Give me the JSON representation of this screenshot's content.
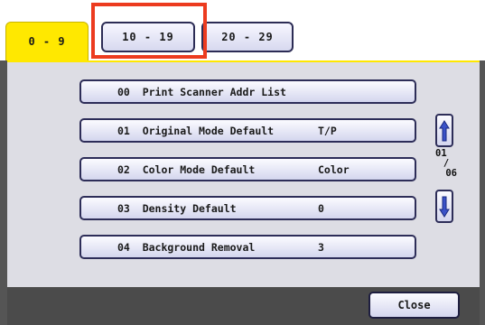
{
  "tabs": [
    {
      "label": "0 - 9",
      "active": true
    },
    {
      "label": "10 - 19",
      "active": false
    },
    {
      "label": "20 - 29",
      "active": false
    }
  ],
  "rows": [
    {
      "label": "00  Print Scanner Addr List",
      "value": ""
    },
    {
      "label": "01  Original Mode Default",
      "value": "T/P"
    },
    {
      "label": "02  Color Mode Default",
      "value": "Color"
    },
    {
      "label": "03  Density Default",
      "value": "0"
    },
    {
      "label": "04  Background Removal",
      "value": "3"
    }
  ],
  "pager": {
    "current": "01",
    "separator": "/",
    "total": "06"
  },
  "close_label": "Close",
  "colors": {
    "active_tab": "#ffe800",
    "highlight": "#ec3b1f",
    "arrow": "#3a52c8"
  },
  "icons": {
    "up": "arrow-up-icon",
    "down": "arrow-down-icon"
  }
}
